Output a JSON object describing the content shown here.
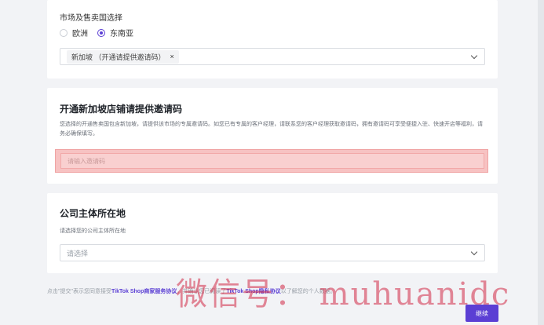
{
  "market": {
    "label": "市场及售卖国选择",
    "options": [
      "欧洲",
      "东南亚"
    ],
    "selected_index": 1,
    "selected_tag": "新加坡 （开通请提供邀请码）",
    "tag_remove": "×"
  },
  "invite": {
    "title": "开通新加坡店铺请提供邀请码",
    "desc": "您选择的开通售卖国包含新加坡，请提供该市场的专属邀请码。如您已有专属的客户经理，请联系您的客户经理获取邀请码，拥有邀请码可享受便捷入驻、快速开店等福利，请务必确保填写。",
    "placeholder": "请输入邀请码"
  },
  "company": {
    "title": "公司主体所在地",
    "sub": "请选择您的公司主体所在地",
    "placeholder": "请选择"
  },
  "footer": {
    "prefix": "点击\"提交\"表示您同意接受",
    "link1": "TikTok Shop商家服务协议",
    "middle": "，并确认您已阅读了",
    "link2": "TikTok Shop隐私协议",
    "suffix": "以了解您的个人数据。"
  },
  "watermark": "微信号： muhuanidc",
  "continue_label": "继续",
  "colors": {
    "accent": "#5b3fd4",
    "highlight": "#f7c2c2"
  }
}
